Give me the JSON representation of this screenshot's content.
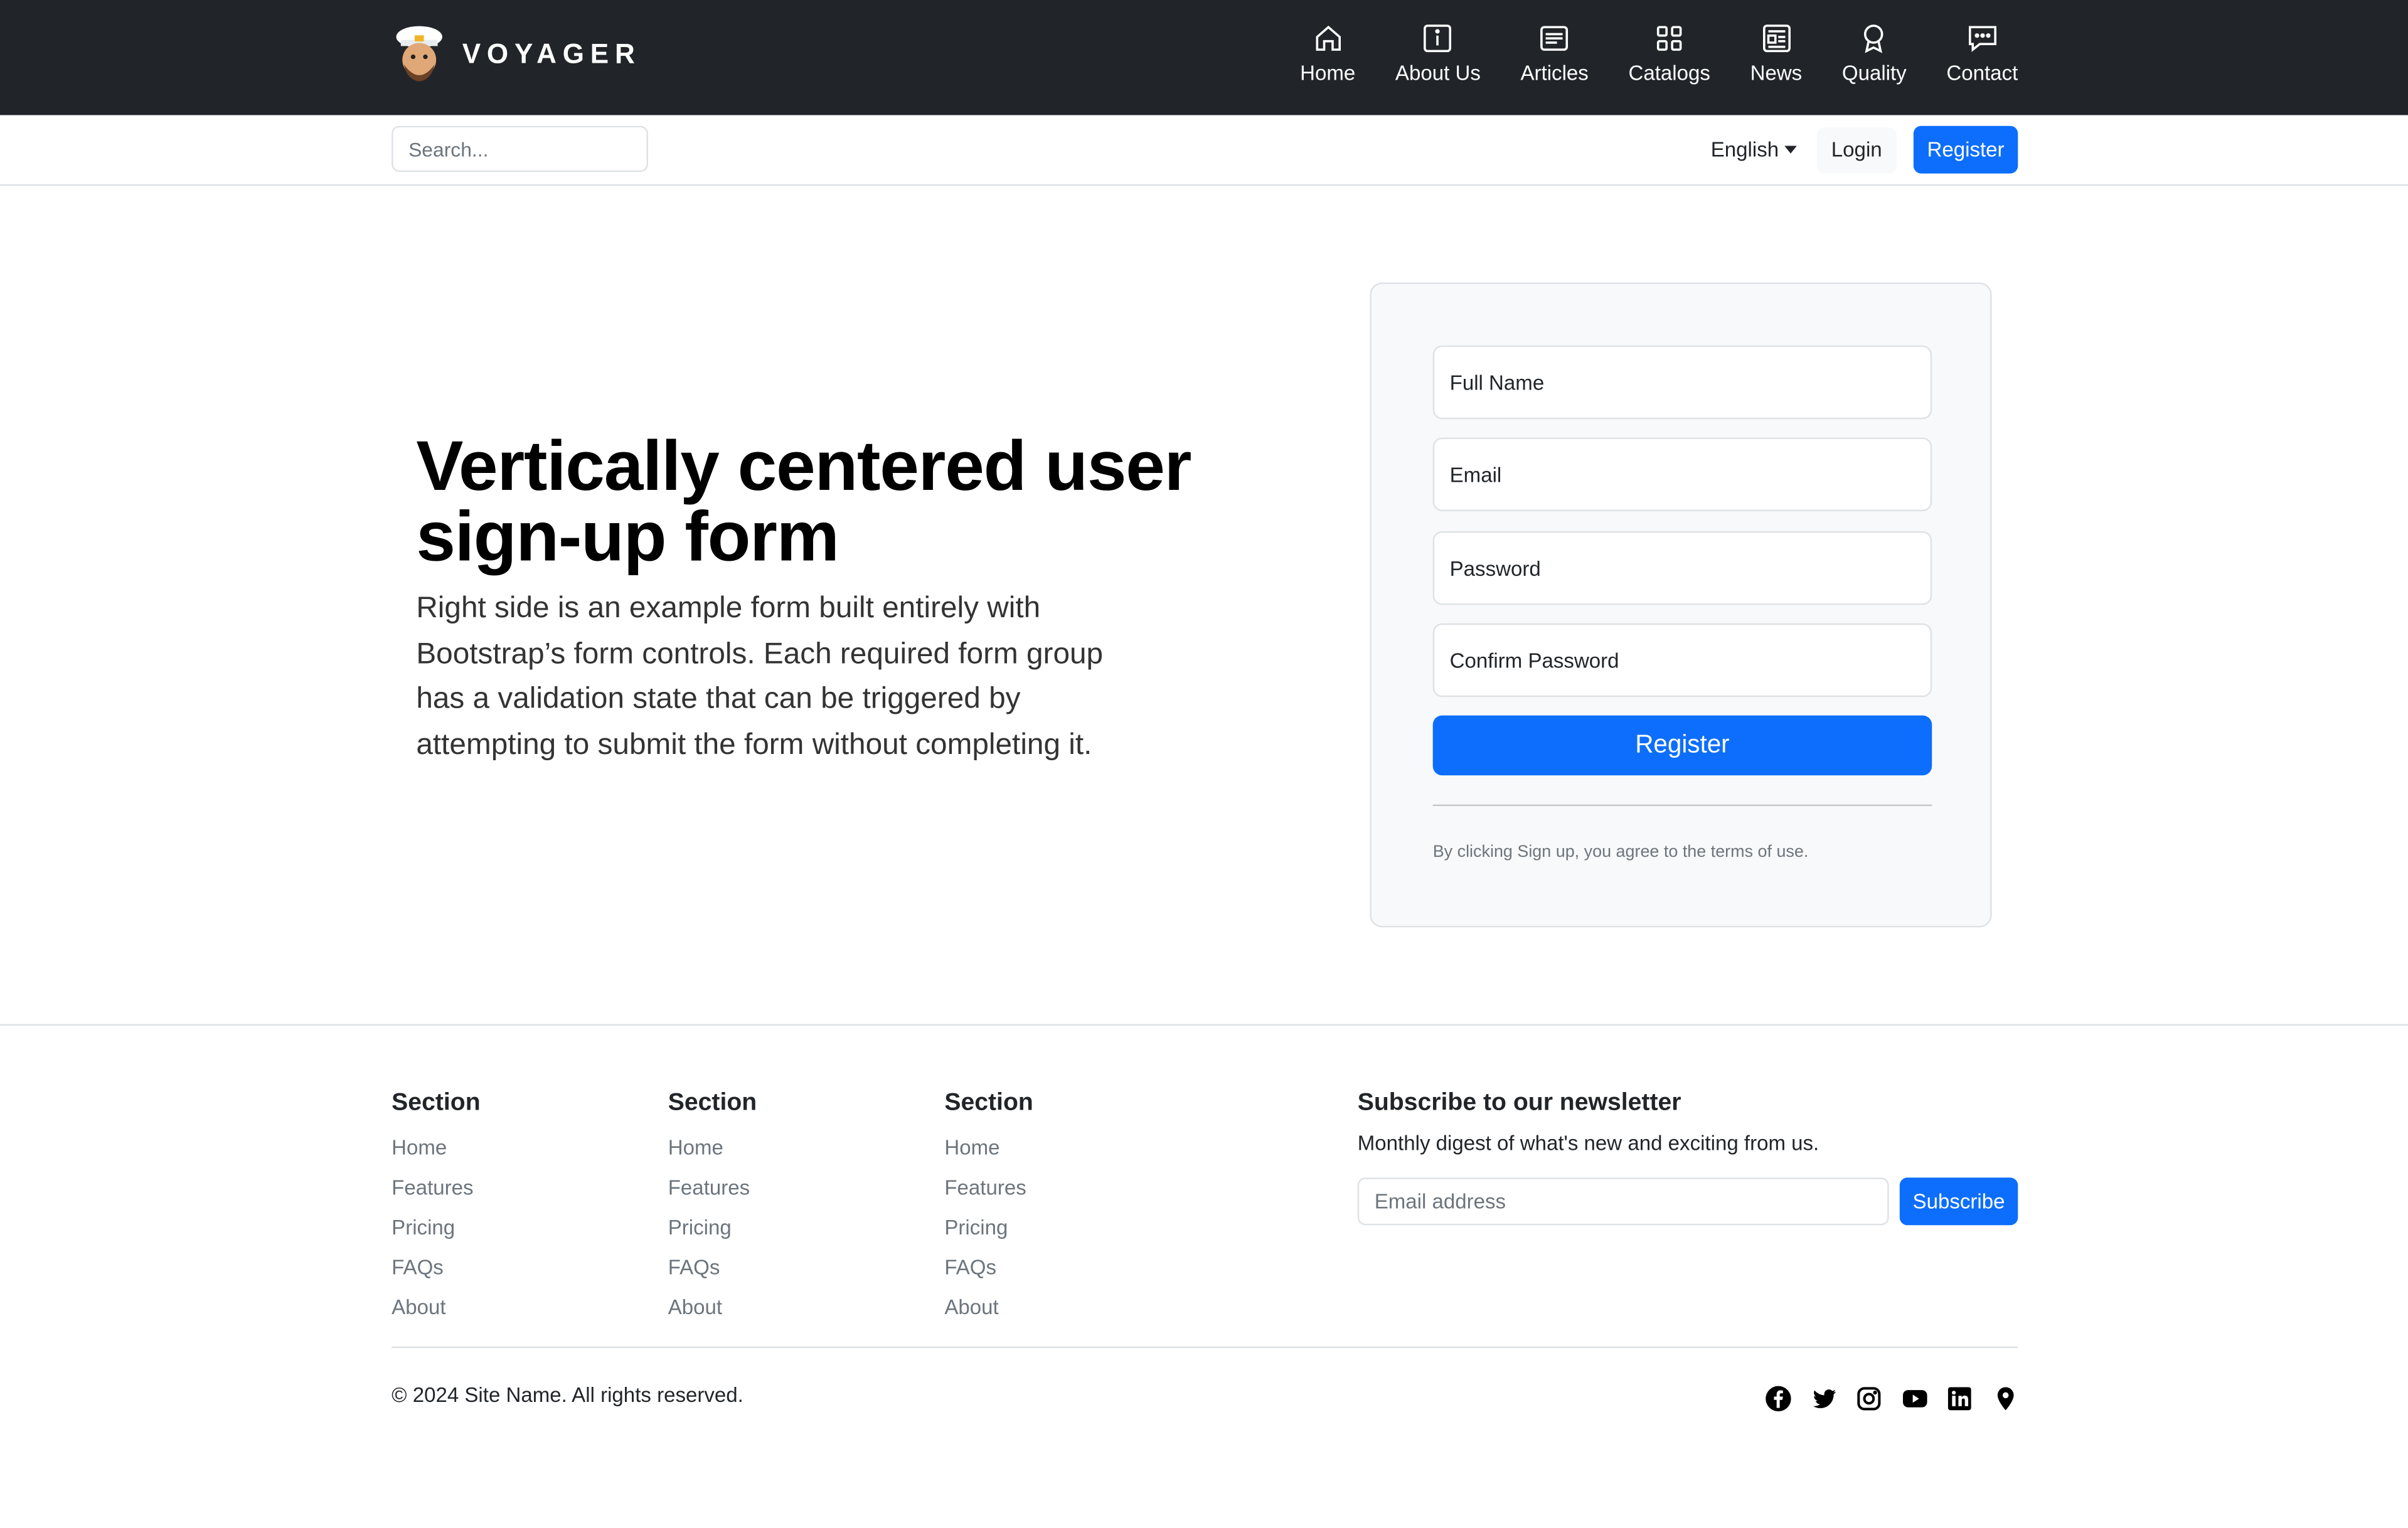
{
  "brand": {
    "name": "VOYAGER"
  },
  "nav": {
    "items": [
      {
        "label": "Home",
        "icon": "home-icon"
      },
      {
        "label": "About Us",
        "icon": "info-icon"
      },
      {
        "label": "Articles",
        "icon": "articles-icon"
      },
      {
        "label": "Catalogs",
        "icon": "grid-icon"
      },
      {
        "label": "News",
        "icon": "newspaper-icon"
      },
      {
        "label": "Quality",
        "icon": "award-icon"
      },
      {
        "label": "Contact",
        "icon": "chat-icon"
      }
    ]
  },
  "subbar": {
    "search_placeholder": "Search...",
    "language": "English",
    "login_label": "Login",
    "register_label": "Register"
  },
  "hero": {
    "title": "Vertically centered user sign-up form",
    "description": "Right side is an example form built entirely with Bootstrap’s form controls. Each required form group has a validation state that can be triggered by attempting to submit the form without completing it."
  },
  "form": {
    "full_name_placeholder": "Full Name",
    "email_placeholder": "Email",
    "password_placeholder": "Password",
    "confirm_password_placeholder": "Confirm Password",
    "submit_label": "Register",
    "note": "By clicking Sign up, you agree to the terms of use."
  },
  "footer": {
    "sections": [
      {
        "title": "Section",
        "links": [
          "Home",
          "Features",
          "Pricing",
          "FAQs",
          "About"
        ]
      },
      {
        "title": "Section",
        "links": [
          "Home",
          "Features",
          "Pricing",
          "FAQs",
          "About"
        ]
      },
      {
        "title": "Section",
        "links": [
          "Home",
          "Features",
          "Pricing",
          "FAQs",
          "About"
        ]
      }
    ],
    "newsletter": {
      "title": "Subscribe to our newsletter",
      "subtitle": "Monthly digest of what's new and exciting from us.",
      "email_placeholder": "Email address",
      "button_label": "Subscribe"
    },
    "copyright": "© 2024 Site Name. All rights reserved.",
    "socials": [
      "facebook-icon",
      "twitter-icon",
      "instagram-icon",
      "youtube-icon",
      "linkedin-icon",
      "location-icon"
    ]
  },
  "colors": {
    "nav_bg": "#212529",
    "primary": "#0d6efd",
    "muted": "#6c757d",
    "card_bg": "#f8f9fa"
  }
}
